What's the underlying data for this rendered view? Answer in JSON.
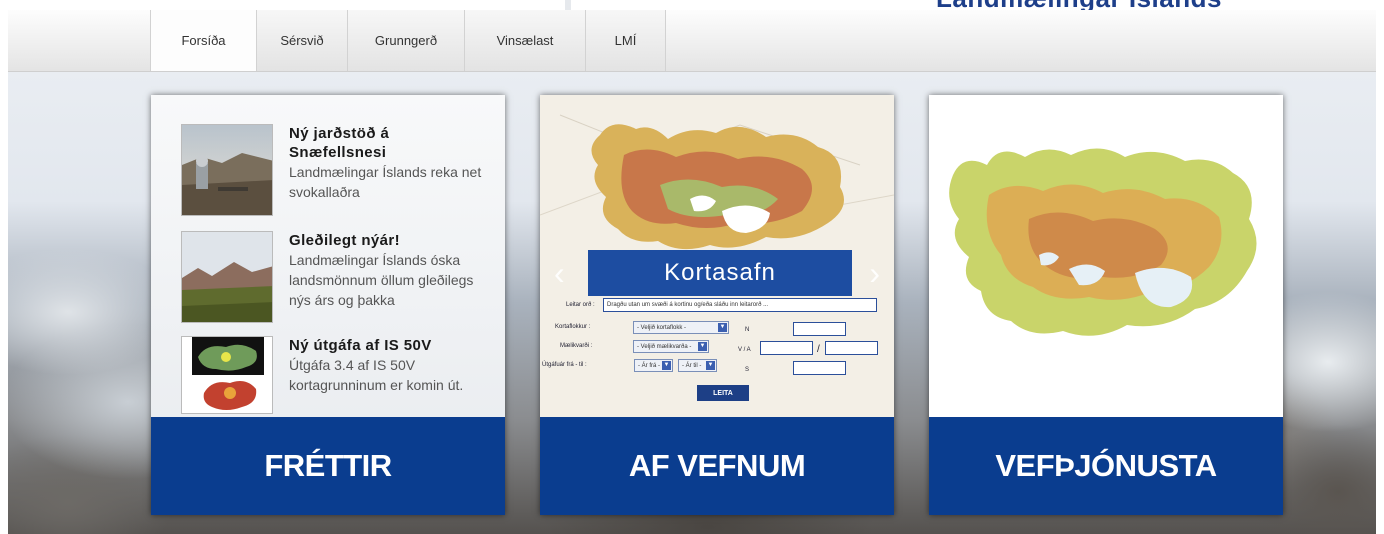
{
  "header": {
    "tagline": "Landmælingar Íslands"
  },
  "nav": {
    "items": [
      {
        "label": "Forsíða",
        "active": true
      },
      {
        "label": "Sérsvið"
      },
      {
        "label": "Grunngerð"
      },
      {
        "label": "Vinsælast"
      },
      {
        "label": "LMÍ"
      }
    ]
  },
  "news_card": {
    "label": "FRÉTTIR",
    "items": [
      {
        "title": "Ný jarðstöð á Snæfellsnesi",
        "body": "Landmælingar Íslands reka net svokallaðra"
      },
      {
        "title": "Gleðilegt nýár!",
        "body": "Landmælingar Íslands óska landsmönnum öllum gleðilegs nýs árs og þakka"
      },
      {
        "title": "Ný útgáfa af IS 50V",
        "body": "Útgáfa 3.4 af IS 50V kortagrunninum er komin út."
      }
    ]
  },
  "web_card": {
    "label": "AF VEFNUM",
    "banner": "Kortasafn",
    "form": {
      "search_label": "Leitar orð :",
      "search_placeholder": "Dragðu utan um svæði á kortinu og/eða sláðu inn leitarorð ...",
      "category_label": "Kortaflokkur :",
      "category_value": "- Veljið kortaflokk -",
      "scale_label": "Mælikvarði :",
      "scale_value": "- Veljið mælikvarða -",
      "year_label": "Útgáfuár frá - til :",
      "year_from": "- Ár frá -",
      "year_to": "- Ár til -",
      "n_label": "N",
      "va_label": "V / A",
      "slash": "/",
      "s_label": "S",
      "button": "LEITA"
    }
  },
  "service_card": {
    "label": "VEFÞJÓNUSTA"
  },
  "colors": {
    "brand_blue": "#0a3d8f",
    "banner_blue": "#1d4da1"
  }
}
